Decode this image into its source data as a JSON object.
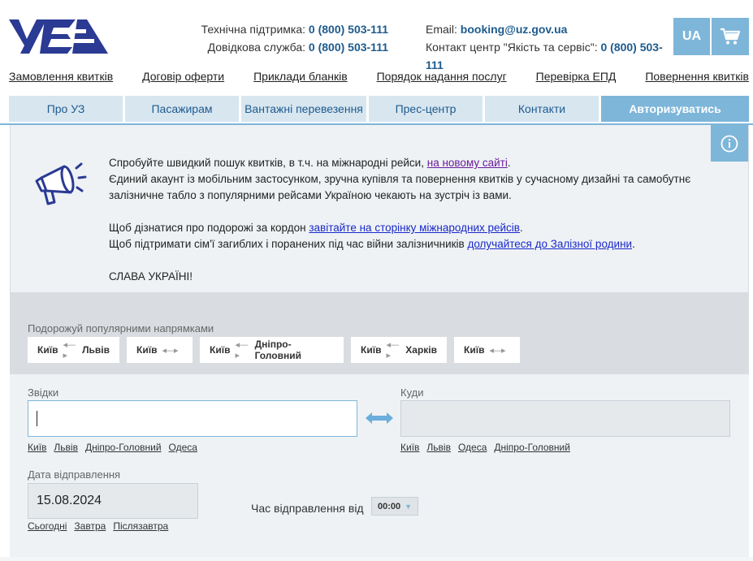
{
  "header": {
    "support_label": "Технічна підтримка:",
    "support_phone": "0 (800) 503-111",
    "info_label": "Довідкова служба:",
    "info_phone": "0 (800) 503-111",
    "email_label": "Email:",
    "email_value": "booking@uz.gov.ua",
    "contact_center_label": "Контакт центр \"Якість та сервіс\":",
    "contact_center_phone": "0 (800) 503-111",
    "lang": "UA",
    "logo_icon": "uz-logo",
    "cart_icon": "cart-icon"
  },
  "top_links": [
    "Замовлення квитків",
    "Договір оферти",
    "Приклади бланків",
    "Порядок надання послуг",
    "Перевірка ЕПД",
    "Повернення квитків"
  ],
  "main_nav": [
    "Про УЗ",
    "Пасажирам",
    "Вантажні перевезення",
    "Прес-центр",
    "Контакти",
    "Авторизуватись"
  ],
  "notice": {
    "line1_pre": "Спробуйте швидкий пошук квитків, в т.ч. на міжнародні рейси, ",
    "line1_link": "на новому сайті",
    "line1_post": ".",
    "line2": "Єдиний акаунт із мобільним застосунком, зручна купівля та повернення квитків у сучасному дизайні та самобутнє залізничне табло з популярними рейсами Україною чекають на зустріч із вами.",
    "line3_pre": "Щоб дізнатися про подорожі за кордон ",
    "line3_link": "завітайте на сторінку міжнародних рейсів",
    "line3_post": ".",
    "line4_pre": "Щоб підтримати сім'ї загиблих і поранених під час війни залізничників ",
    "line4_link": "долучайтеся до Залізної родини",
    "line4_post": ".",
    "line5": "СЛАВА УКРАЇНІ!"
  },
  "popular": {
    "title": "Подорожуй популярними напрямками",
    "arrow": "◂—▸",
    "routes": [
      {
        "from": "Київ",
        "to": "Львів"
      },
      {
        "from": "Київ",
        "to": ""
      },
      {
        "from": "Київ",
        "to": "Дніпро-Головний"
      },
      {
        "from": "Київ",
        "to": "Харків"
      },
      {
        "from": "Київ",
        "to": ""
      }
    ]
  },
  "form": {
    "from_label": "Звідки",
    "from_value": "",
    "to_label": "Куди",
    "to_value": "",
    "from_quick": [
      "Київ",
      "Львів",
      "Дніпро-Головний",
      "Одеса"
    ],
    "to_quick": [
      "Київ",
      "Львів",
      "Одеса",
      "Дніпро-Головний"
    ],
    "date_label": "Дата відправлення",
    "date_value": "15.08.2024",
    "date_quick": [
      "Сьогодні",
      "Завтра",
      "Післязавтра"
    ],
    "time_label": "Час відправлення від",
    "time_value": "00:00"
  },
  "colors": {
    "accent": "#7eb6d9",
    "brand_blue": "#2b3a93",
    "link": "#1a28c9"
  }
}
